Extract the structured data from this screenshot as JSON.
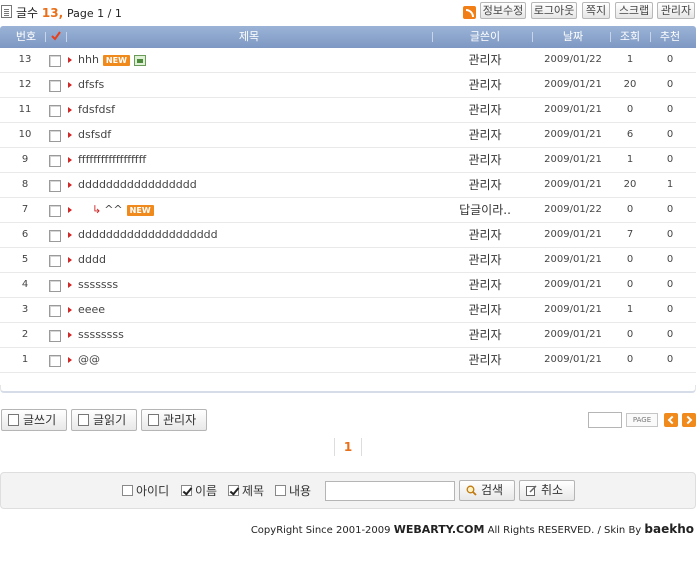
{
  "board": {
    "count_label": "글수",
    "count_value": "13,",
    "page_info": "Page 1 / 1"
  },
  "toolbar": {
    "profile_edit": "정보수정",
    "logout": "로그아웃",
    "memo": "쪽지",
    "scrap": "스크랩",
    "admin": "관리자"
  },
  "columns": {
    "no": "번호",
    "title": "제목",
    "author": "글쓴이",
    "date": "날짜",
    "views": "조회",
    "recommend": "추천"
  },
  "posts": [
    {
      "no": "13",
      "title": "hhh",
      "new": "NEW",
      "has_image": true,
      "reply": false,
      "author": "관리자",
      "date": "2009/01/22",
      "views": "1",
      "recommend": "0"
    },
    {
      "no": "12",
      "title": "dfsfs",
      "new": "",
      "has_image": false,
      "reply": false,
      "author": "관리자",
      "date": "2009/01/21",
      "views": "20",
      "recommend": "0"
    },
    {
      "no": "11",
      "title": "fdsfdsf",
      "new": "",
      "has_image": false,
      "reply": false,
      "author": "관리자",
      "date": "2009/01/21",
      "views": "0",
      "recommend": "0"
    },
    {
      "no": "10",
      "title": "dsfsdf",
      "new": "",
      "has_image": false,
      "reply": false,
      "author": "관리자",
      "date": "2009/01/21",
      "views": "6",
      "recommend": "0"
    },
    {
      "no": "9",
      "title": "ffffffffffffffffff",
      "new": "",
      "has_image": false,
      "reply": false,
      "author": "관리자",
      "date": "2009/01/21",
      "views": "1",
      "recommend": "0"
    },
    {
      "no": "8",
      "title": "ddddddddddddddddd",
      "new": "",
      "has_image": false,
      "reply": false,
      "author": "관리자",
      "date": "2009/01/21",
      "views": "20",
      "recommend": "1"
    },
    {
      "no": "7",
      "title": "^^",
      "new": "NEW",
      "has_image": false,
      "reply": true,
      "author": "답글이라..",
      "date": "2009/01/22",
      "views": "0",
      "recommend": "0"
    },
    {
      "no": "6",
      "title": "dddddddddddddddddddd",
      "new": "",
      "has_image": false,
      "reply": false,
      "author": "관리자",
      "date": "2009/01/21",
      "views": "7",
      "recommend": "0"
    },
    {
      "no": "5",
      "title": "dddd",
      "new": "",
      "has_image": false,
      "reply": false,
      "author": "관리자",
      "date": "2009/01/21",
      "views": "0",
      "recommend": "0"
    },
    {
      "no": "4",
      "title": "sssssss",
      "new": "",
      "has_image": false,
      "reply": false,
      "author": "관리자",
      "date": "2009/01/21",
      "views": "0",
      "recommend": "0"
    },
    {
      "no": "3",
      "title": "eeee",
      "new": "",
      "has_image": false,
      "reply": false,
      "author": "관리자",
      "date": "2009/01/21",
      "views": "1",
      "recommend": "0"
    },
    {
      "no": "2",
      "title": "ssssssss",
      "new": "",
      "has_image": false,
      "reply": false,
      "author": "관리자",
      "date": "2009/01/21",
      "views": "0",
      "recommend": "0"
    },
    {
      "no": "1",
      "title": "@@",
      "new": "",
      "has_image": false,
      "reply": false,
      "author": "관리자",
      "date": "2009/01/21",
      "views": "0",
      "recommend": "0"
    }
  ],
  "actions": {
    "write": "글쓰기",
    "read": "글읽기",
    "admin": "관리자"
  },
  "pagination": {
    "go_label": "PAGE",
    "current_page": "1"
  },
  "search": {
    "opt_id": "아이디",
    "opt_name": "이름",
    "opt_subject": "제목",
    "opt_content": "내용",
    "opt_name_checked": true,
    "opt_subject_checked": true,
    "query": "",
    "search_button": "검색",
    "cancel_button": "취소"
  },
  "footer": {
    "copyright": "CopyRight Since 2001-2009",
    "site": "WEBARTY.COM",
    "rights": "All Rights RESERVED. / Skin By",
    "author": "baekho"
  },
  "colors": {
    "accent": "#e8701a",
    "header": "#8aa3cc",
    "reply_arrow": "#d02727"
  }
}
